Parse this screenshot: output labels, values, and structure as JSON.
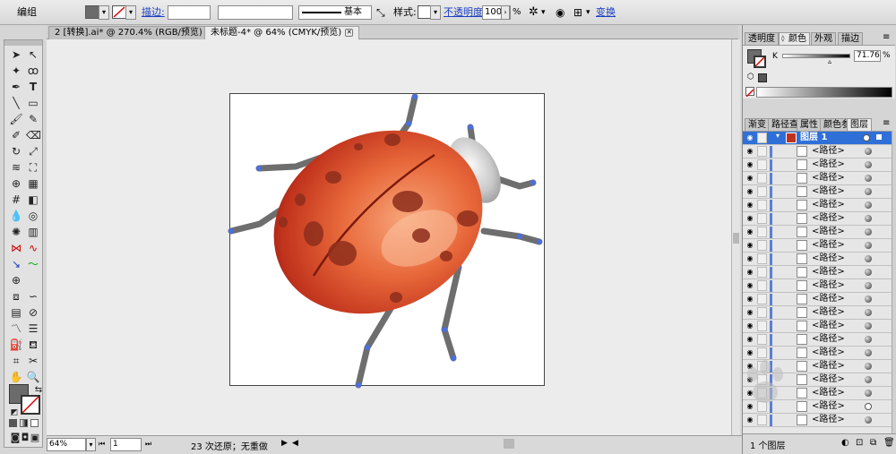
{
  "control_bar": {
    "mode_label": "编组",
    "stroke_link": "描边:",
    "stroke_style_label": "基本",
    "style_label": "样式:",
    "opacity_link": "不透明度:",
    "opacity_value": "100",
    "opacity_unit": "%",
    "transform_link": "变换"
  },
  "document_tabs": [
    {
      "label": "2 [转换].ai* @ 270.4% (RGB/预览)"
    },
    {
      "label": "未标题-4* @ 64% (CMYK/预览)"
    }
  ],
  "color_panel": {
    "tabs": [
      "透明度",
      "颜色",
      "外观",
      "描边"
    ],
    "channel_label": "K",
    "k_value": "71.76",
    "k_unit": "%",
    "fill_color": "#6b6b6b"
  },
  "layers_panel": {
    "tabs": [
      "渐变",
      "路径查",
      "属性",
      "颜色参",
      "图层"
    ],
    "top_layer": "图层 1",
    "item_label": "<路径>",
    "footer_label": "1 个图层"
  },
  "status_bar": {
    "zoom": "64%",
    "page": "1",
    "history": "23 次还原；无重做"
  },
  "colors": {
    "selection_blue": "#4a6fe0",
    "layer_highlight": "#2f6fd8",
    "ladybug_red": "#c0321c",
    "ladybug_orange": "#e8683a"
  },
  "watermark_text": "百度经验 jingyan.baidu.com"
}
